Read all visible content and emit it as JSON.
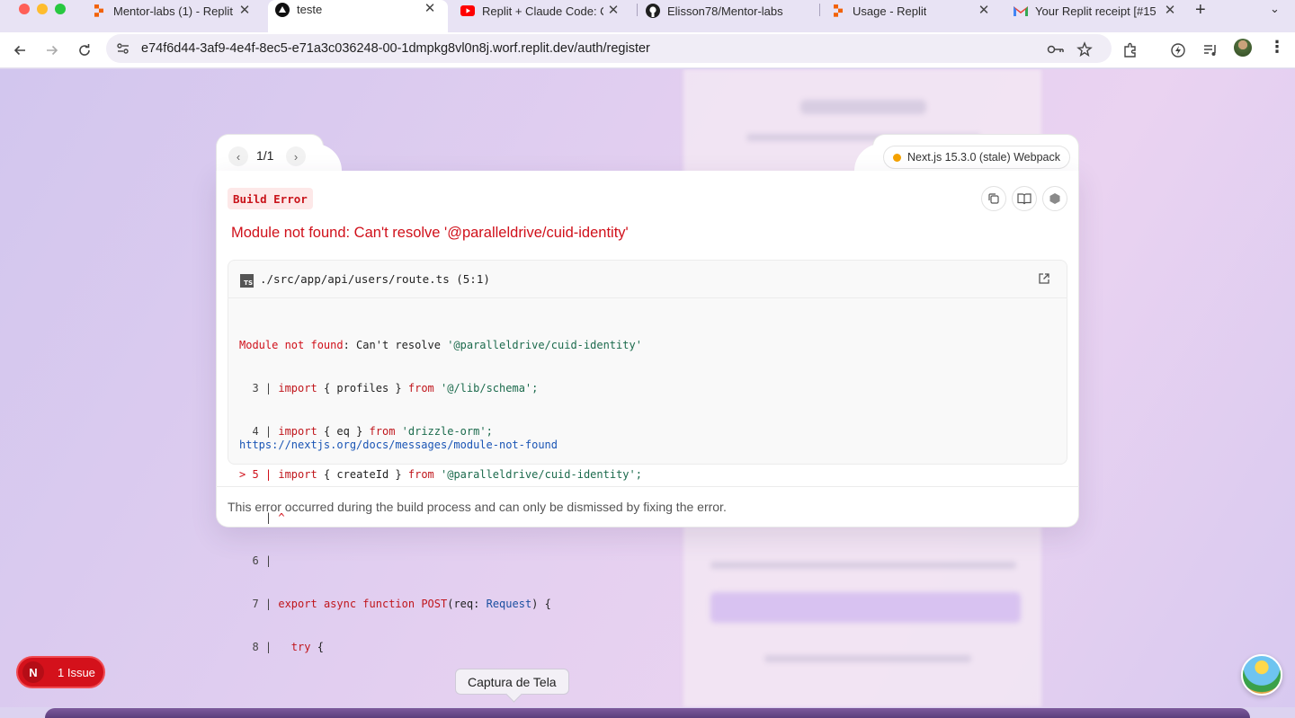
{
  "browser": {
    "tabs": [
      {
        "title": "Mentor-labs (1) - Replit",
        "icon": "replit-icon",
        "active": false
      },
      {
        "title": "teste",
        "icon": "vercel-triangle-icon",
        "active": true
      },
      {
        "title": "Replit + Claude Code: C",
        "icon": "youtube-icon",
        "active": false
      },
      {
        "title": "Elisson78/Mentor-labs",
        "icon": "github-icon",
        "active": false
      },
      {
        "title": "Usage - Replit",
        "icon": "replit-icon",
        "active": false
      },
      {
        "title": "Your Replit receipt [#15",
        "icon": "gmail-icon",
        "active": false
      }
    ],
    "new_tab": "+",
    "url": "e74f6d44-3af9-4e4f-8ec5-e71a3c036248-00-1dmpkg8vl0n8j.worf.replit.dev/auth/register"
  },
  "overlay": {
    "pager": {
      "text": "1/1",
      "prev": "‹",
      "next": "›"
    },
    "version": "Next.js 15.3.0 (stale) Webpack",
    "badge": "Build Error",
    "title": "Module not found: Can't resolve '@paralleldrive/cuid-identity'",
    "file": {
      "type_icon": "TS",
      "path": "./src/app/api/users/route.ts (5:1)"
    },
    "code": {
      "error_prefix": "Module not found",
      "error_rest": ": Can't resolve ",
      "error_module": "'@paralleldrive/cuid-identity'",
      "lines": [
        {
          "gutter": "  3 | ",
          "kw": "import",
          "a": " { profiles } ",
          "kw2": "from",
          "str": " '@/lib/schema'",
          "end": ";"
        },
        {
          "gutter": "  4 | ",
          "kw": "import",
          "a": " { eq } ",
          "kw2": "from",
          "str": " 'drizzle-orm'",
          "end": ";"
        },
        {
          "gutter": "> 5 | ",
          "kw": "import",
          "a": " { createId } ",
          "kw2": "from",
          "str": " '@paralleldrive/cuid-identity'",
          "end": ";"
        },
        {
          "gutter": "    | ",
          "caret": "^"
        },
        {
          "gutter": "  6 | "
        },
        {
          "gutter": "  7 | ",
          "kw": "export",
          "kw_b": " async",
          "kw_c": " function",
          "fn": " POST",
          "a": "(req: ",
          "type": "Request",
          "end": ") {"
        },
        {
          "gutter": "  8 | ",
          "kw": "  try",
          "end": " {"
        }
      ],
      "link": "https://nextjs.org/docs/messages/module-not-found"
    },
    "footer": "This error occurred during the build process and can only be dismissed by fixing the error."
  },
  "issues": {
    "label": "1 Issue",
    "logo": "N"
  },
  "tooltip": "Captura de Tela",
  "colors": {
    "error_red": "#d0101a",
    "badge_bg": "#fde8e8",
    "status_dot": "#f5a200",
    "link_blue": "#1a55b5"
  }
}
